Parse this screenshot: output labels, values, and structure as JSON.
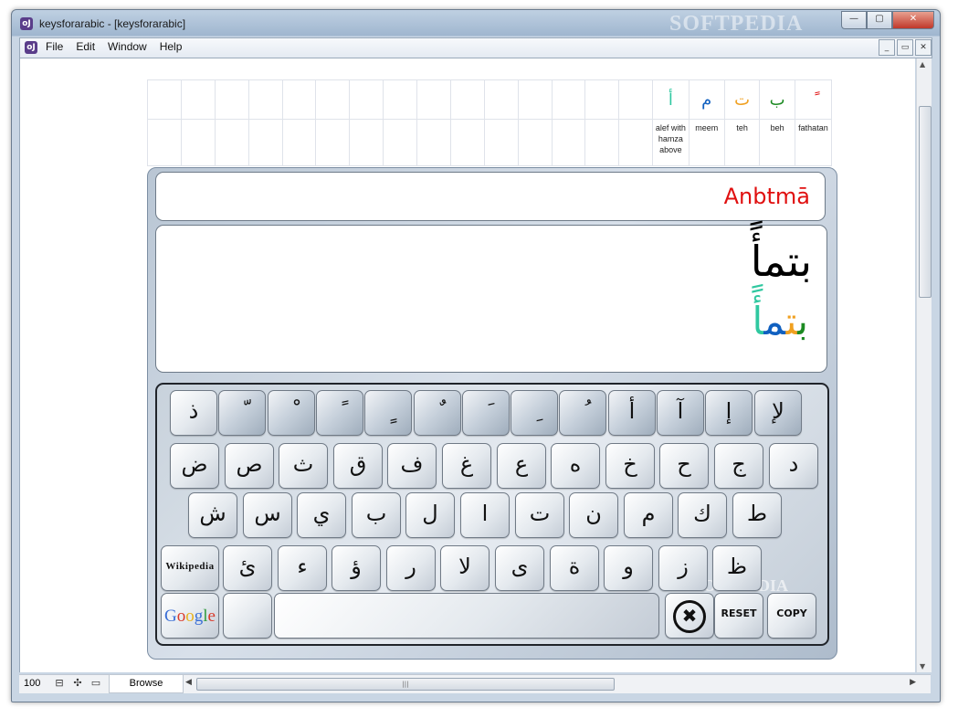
{
  "window": {
    "title": "keysforarabic - [keysforarabic]",
    "watermark": "SOFTPEDIA",
    "controls": [
      "—",
      "▢",
      "✕"
    ]
  },
  "menu": {
    "items": [
      "File",
      "Edit",
      "Window",
      "Help"
    ],
    "mdi_controls": [
      "_",
      "▭",
      "✕"
    ]
  },
  "letters": [
    {
      "glyph": "ً",
      "name": "fathatan",
      "color": "#e01010"
    },
    {
      "glyph": "ب",
      "name": "beh",
      "color": "#1c8a22"
    },
    {
      "glyph": "ت",
      "name": "teh",
      "color": "#f0a020"
    },
    {
      "glyph": "م",
      "name": "meem",
      "color": "#1060c0"
    },
    {
      "glyph": "أ",
      "name": "alef with hamza above",
      "color": "#30c8a0"
    }
  ],
  "translit": "Anbtmā",
  "output_text": "بتمأً",
  "output_colored": [
    {
      "ch": "ب",
      "color": "#1c8a22"
    },
    {
      "ch": "ت",
      "color": "#f0a020"
    },
    {
      "ch": "م",
      "color": "#1060c0"
    },
    {
      "ch": "أ",
      "color": "#30c8a0"
    },
    {
      "ch": "ً",
      "color": "#e01010"
    }
  ],
  "keyboard": {
    "row1": [
      "ذ",
      "ّ",
      "ْ",
      "ً",
      "ٍ",
      "ٌ",
      "َ",
      "ِ",
      "ُ",
      "أ",
      "آ",
      "إ",
      "لإ"
    ],
    "row2": [
      "ض",
      "ص",
      "ث",
      "ق",
      "ف",
      "غ",
      "ع",
      "ه",
      "خ",
      "ح",
      "ج",
      "د"
    ],
    "row3": [
      "ش",
      "س",
      "ي",
      "ب",
      "ل",
      "ا",
      "ت",
      "ن",
      "م",
      "ك",
      "ط"
    ],
    "row4": [
      "ئ",
      "ء",
      "ؤ",
      "ر",
      "لا",
      "ى",
      "ة",
      "و",
      "ز",
      "ظ"
    ],
    "wikipedia_label": "Wikipedia",
    "google_label": "Google",
    "clear_symbol": "✖",
    "reset_label": "RESET",
    "copy_label": "COPY",
    "watermark": "SOFTPEDIA"
  },
  "statusbar": {
    "zoom": "100",
    "tab": "Browse"
  }
}
